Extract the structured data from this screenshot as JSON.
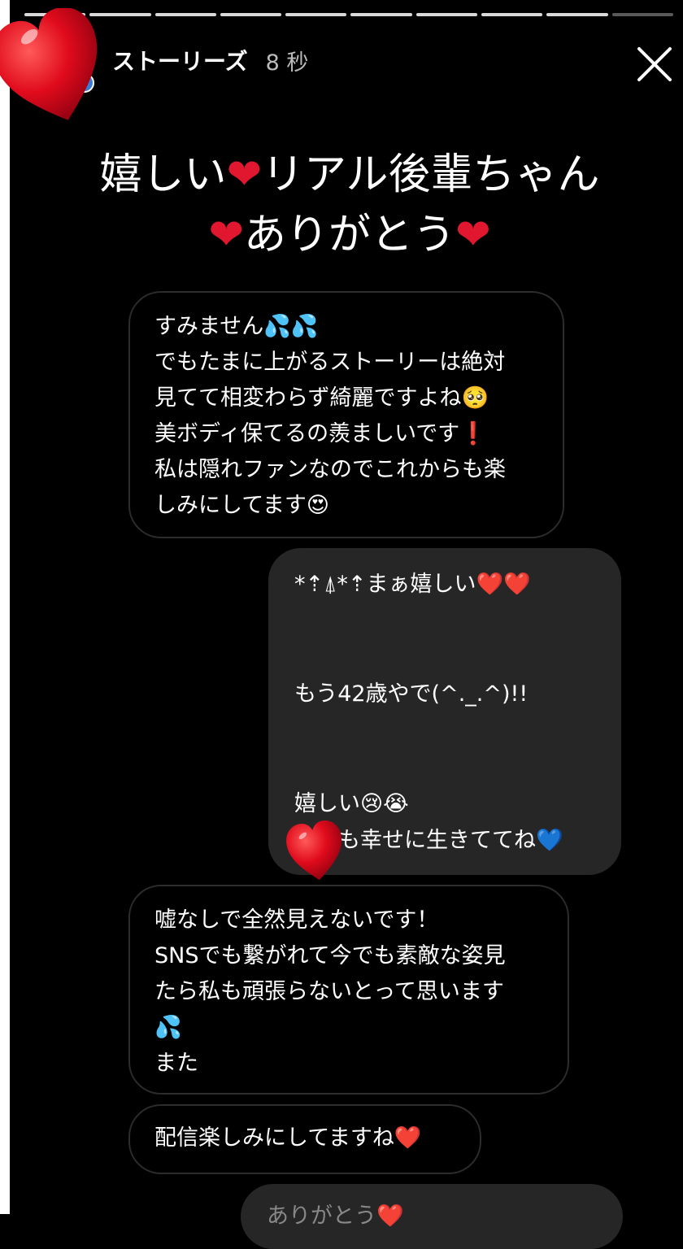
{
  "story": {
    "name": "ストーリーズ",
    "time": "8 秒",
    "segments_total": 10,
    "segments_viewed": 9
  },
  "caption": {
    "line1_a": "嬉しい",
    "line1_heart": "❤",
    "line1_b": "リアル後輩ちゃん",
    "line2_heart_a": "❤",
    "line2_text": "ありがとう",
    "line2_heart_b": "❤"
  },
  "messages": [
    {
      "side": "received",
      "text": "すみません💦💦\nでもたまに上がるストーリーは絶対\n見てて相変わらず綺麗ですよね🥺\n美ボディ保てるの羨ましいです❗️\n私は隠れファンなのでこれからも楽\nしみにしてます😍"
    },
    {
      "side": "sent",
      "text": "*⇡⍋*⇡まぁ嬉しい❤️❤️\n\n\nもう42歳やで(^._.^)!!\n\n\n嬉しい😢😭\n　　も幸せに生きててね💙"
    },
    {
      "side": "received",
      "text": "嘘なしで全然見えないです！\nSNSでも繋がれて今でも素敵な姿見\nたら私も頑張らないとって思います\n💦\nまた"
    },
    {
      "side": "received",
      "text": "配信楽しみにしてますね❤️"
    },
    {
      "side": "sent",
      "text": "ありがとう❤️"
    }
  ],
  "colors": {
    "background": "#000000",
    "sent_bubble": "#262626",
    "received_border": "#2c2c2c",
    "heart": "#e0172f"
  },
  "icons": [
    "close-icon",
    "heart-sticker",
    "profile-badge-icon"
  ]
}
